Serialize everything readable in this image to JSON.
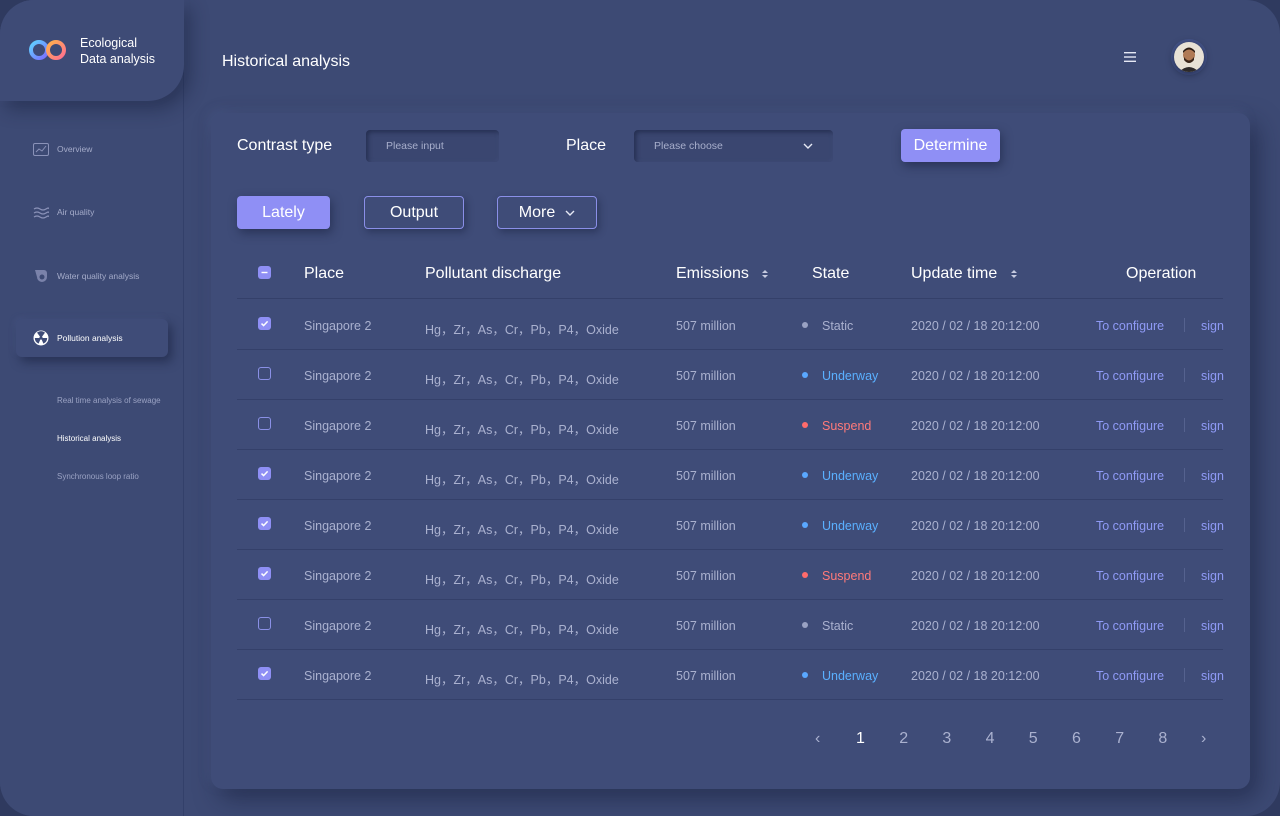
{
  "brand": {
    "line1": "Ecological",
    "line2": "Data analysis"
  },
  "sidebar": {
    "items": [
      {
        "label": "Overview",
        "icon": "chart-icon"
      },
      {
        "label": "Air quality",
        "icon": "waves-icon"
      },
      {
        "label": "Water quality analysis",
        "icon": "drop-icon"
      },
      {
        "label": "Pollution analysis",
        "icon": "radiation-icon",
        "active": true
      }
    ],
    "subitems": [
      {
        "label": "Real time analysis of sewage"
      },
      {
        "label": "Historical analysis",
        "active": true
      },
      {
        "label": "Synchronous loop ratio"
      }
    ]
  },
  "header": {
    "title": "Historical analysis"
  },
  "filters": {
    "contrast_label": "Contrast type",
    "contrast_placeholder": "Please input",
    "place_label": "Place",
    "place_placeholder": "Please choose",
    "determine_label": "Determine"
  },
  "actions": {
    "lately": "Lately",
    "output": "Output",
    "more": "More"
  },
  "table": {
    "headers": {
      "place": "Place",
      "pollutant": "Pollutant discharge",
      "emissions": "Emissions",
      "state": "State",
      "update": "Update time",
      "operation": "Operation"
    },
    "rows": [
      {
        "checked": true,
        "place": "Singapore 2",
        "pollutant": "Hg，Zr，As，Cr，Pb，P4，Oxide",
        "emissions": "507 million",
        "state": "Static",
        "time": "2020 / 02 / 18  20:12:00",
        "op1": "To configure",
        "op2": "sign"
      },
      {
        "checked": false,
        "place": "Singapore 2",
        "pollutant": "Hg，Zr，As，Cr，Pb，P4，Oxide",
        "emissions": "507 million",
        "state": "Underway",
        "time": "2020 / 02 / 18  20:12:00",
        "op1": "To configure",
        "op2": "sign"
      },
      {
        "checked": false,
        "place": "Singapore 2",
        "pollutant": "Hg，Zr，As，Cr，Pb，P4，Oxide",
        "emissions": "507 million",
        "state": "Suspend",
        "time": "2020 / 02 / 18  20:12:00",
        "op1": "To configure",
        "op2": "sign"
      },
      {
        "checked": true,
        "place": "Singapore 2",
        "pollutant": "Hg，Zr，As，Cr，Pb，P4，Oxide",
        "emissions": "507 million",
        "state": "Underway",
        "time": "2020 / 02 / 18  20:12:00",
        "op1": "To configure",
        "op2": "sign"
      },
      {
        "checked": true,
        "place": "Singapore 2",
        "pollutant": "Hg，Zr，As，Cr，Pb，P4，Oxide",
        "emissions": "507 million",
        "state": "Underway",
        "time": "2020 / 02 / 18  20:12:00",
        "op1": "To configure",
        "op2": "sign"
      },
      {
        "checked": true,
        "place": "Singapore 2",
        "pollutant": "Hg，Zr，As，Cr，Pb，P4，Oxide",
        "emissions": "507 million",
        "state": "Suspend",
        "time": "2020 / 02 / 18  20:12:00",
        "op1": "To configure",
        "op2": "sign"
      },
      {
        "checked": false,
        "place": "Singapore 2",
        "pollutant": "Hg，Zr，As，Cr，Pb，P4，Oxide",
        "emissions": "507 million",
        "state": "Static",
        "time": "2020 / 02 / 18  20:12:00",
        "op1": "To configure",
        "op2": "sign"
      },
      {
        "checked": true,
        "place": "Singapore 2",
        "pollutant": "Hg，Zr，As，Cr，Pb，P4，Oxide",
        "emissions": "507 million",
        "state": "Underway",
        "time": "2020 / 02 / 18  20:12:00",
        "op1": "To configure",
        "op2": "sign"
      }
    ]
  },
  "state_colors": {
    "Static": "#9aa2c3",
    "Underway": "#5aa8ff",
    "Suspend": "#ff6b6b"
  },
  "state_text_colors": {
    "Static": "#aab1cf",
    "Underway": "#5ab0ff",
    "Suspend": "#ff7a7a"
  },
  "pagination": {
    "prev": "‹",
    "pages": [
      "1",
      "2",
      "3",
      "4",
      "5",
      "6",
      "7",
      "8"
    ],
    "current": "1",
    "next": "›"
  },
  "colors": {
    "accent": "#8f8ff5",
    "background": "#3d4a74"
  }
}
